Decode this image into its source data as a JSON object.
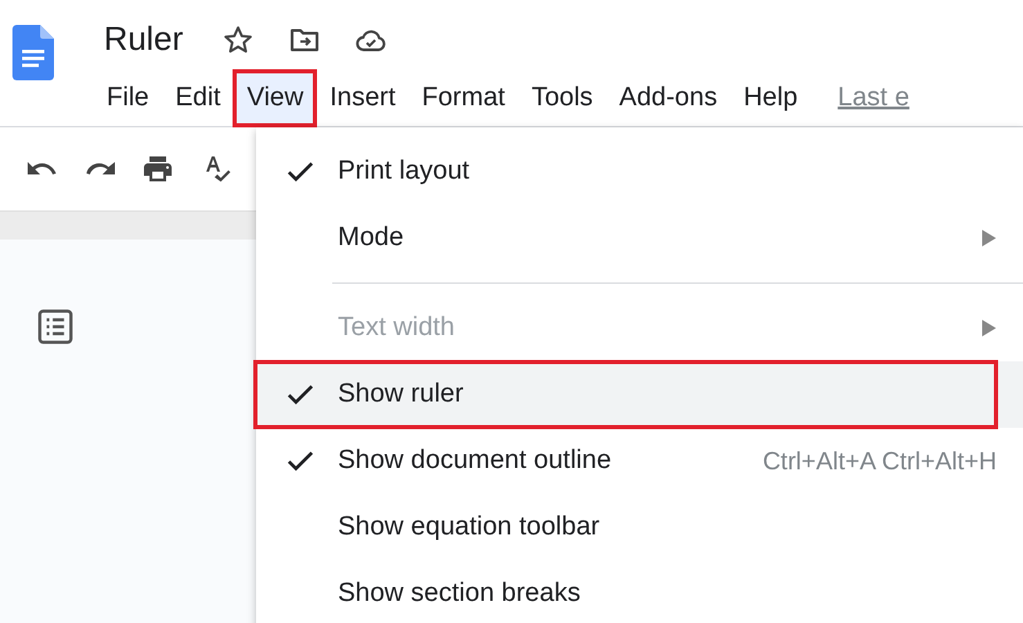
{
  "document": {
    "title": "Ruler"
  },
  "menubar": [
    {
      "label": "File",
      "selected": false,
      "annotated": false
    },
    {
      "label": "Edit",
      "selected": false,
      "annotated": false
    },
    {
      "label": "View",
      "selected": true,
      "annotated": true
    },
    {
      "label": "Insert",
      "selected": false,
      "annotated": false
    },
    {
      "label": "Format",
      "selected": false,
      "annotated": false
    },
    {
      "label": "Tools",
      "selected": false,
      "annotated": false
    },
    {
      "label": "Add-ons",
      "selected": false,
      "annotated": false
    },
    {
      "label": "Help",
      "selected": false,
      "annotated": false
    }
  ],
  "last_edit_link": "Last e",
  "view_menu": [
    {
      "kind": "item",
      "label": "Print layout",
      "checked": true,
      "disabled": false,
      "highlighted": false,
      "annotated": false,
      "submenu": false
    },
    {
      "kind": "item",
      "label": "Mode",
      "checked": false,
      "disabled": false,
      "highlighted": false,
      "annotated": false,
      "submenu": true
    },
    {
      "kind": "divider"
    },
    {
      "kind": "item",
      "label": "Text width",
      "checked": false,
      "disabled": true,
      "highlighted": false,
      "annotated": false,
      "submenu": true
    },
    {
      "kind": "item",
      "label": "Show ruler",
      "checked": true,
      "disabled": false,
      "highlighted": true,
      "annotated": true,
      "submenu": false
    },
    {
      "kind": "item",
      "label": "Show document outline",
      "checked": true,
      "disabled": false,
      "highlighted": false,
      "annotated": false,
      "submenu": false,
      "shortcut": "Ctrl+Alt+A Ctrl+Alt+H"
    },
    {
      "kind": "item",
      "label": "Show equation toolbar",
      "checked": false,
      "disabled": false,
      "highlighted": false,
      "annotated": false,
      "submenu": false
    },
    {
      "kind": "item",
      "label": "Show section breaks",
      "checked": false,
      "disabled": false,
      "highlighted": false,
      "annotated": false,
      "submenu": false
    }
  ]
}
